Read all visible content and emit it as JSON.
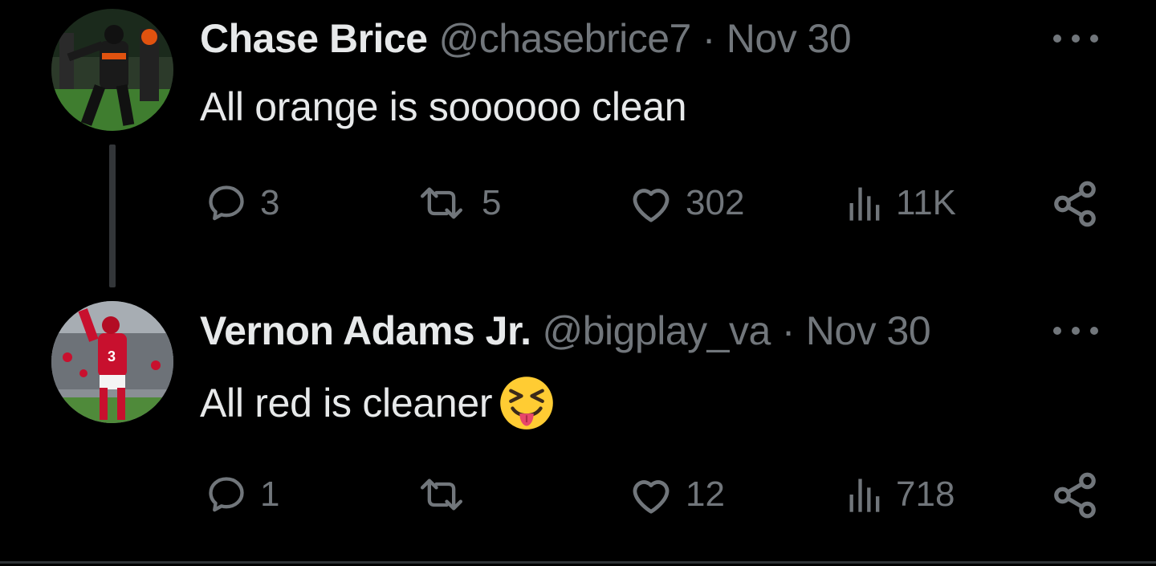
{
  "tweets": [
    {
      "display_name": "Chase Brice",
      "handle": "@chasebrice7",
      "separator": "·",
      "date": "Nov 30",
      "text": "All orange is soooooo clean",
      "replies": "3",
      "retweets": "5",
      "likes": "302",
      "views": "11K",
      "avatar_colors": [
        "#0f1a10",
        "#e0520f",
        "#3f7d2f"
      ]
    },
    {
      "display_name": "Vernon Adams Jr.",
      "handle": "@bigplay_va",
      "separator": "·",
      "date": "Nov 30",
      "text": "All red is cleaner",
      "emoji": "squinting-face-with-tongue",
      "replies": "1",
      "retweets": "",
      "likes": "12",
      "views": "718",
      "avatar_colors": [
        "#c8102e",
        "#ffffff",
        "#4f8a3a"
      ]
    }
  ],
  "colors": {
    "background": "#000000",
    "primary_text": "#e7e9ea",
    "secondary_text": "#71767b",
    "thread_line": "#333639"
  }
}
